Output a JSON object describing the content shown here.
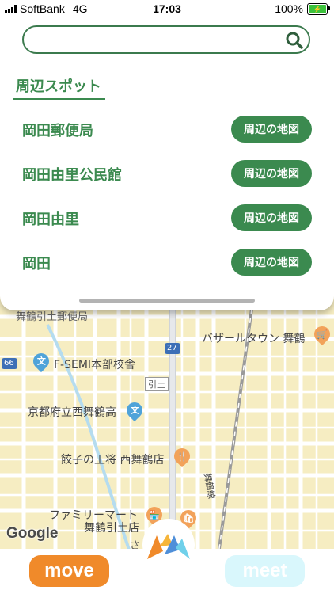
{
  "status_bar": {
    "carrier": "SoftBank",
    "network": "4G",
    "time": "17:03",
    "battery": "100%"
  },
  "search": {
    "placeholder": "",
    "icon": "search-icon"
  },
  "spots": {
    "title": "周辺スポット",
    "items": [
      {
        "name": "岡田郵便局",
        "button": "周辺の地図"
      },
      {
        "name": "岡田由里公民館",
        "button": "周辺の地図"
      },
      {
        "name": "岡田由里",
        "button": "周辺の地図"
      },
      {
        "name": "岡田",
        "button": "周辺の地図"
      }
    ]
  },
  "map": {
    "labels": {
      "bazaar": "バザールタウン 舞鶴",
      "fsemi": "F-SEMI本部校舎",
      "hikitsuchi": "引土",
      "school": "京都府立西舞鶴高",
      "gyoza": "餃子の王将 西舞鶴店",
      "familymart_1": "ファミリーマート",
      "familymart_2": "舞鶴引土店",
      "maizuru_line": "舞鶴線",
      "route_27": "27",
      "route_66": "66",
      "partial_top": "舞鶴引土郵便局",
      "partial_bottom": "さ"
    },
    "attribution": "Google"
  },
  "bottom": {
    "move_label": "move",
    "meet_label": "meet"
  },
  "colors": {
    "accent_green": "#3b8a4f",
    "move_orange": "#f08a2a",
    "meet_cyan": "#d9f7fc"
  }
}
